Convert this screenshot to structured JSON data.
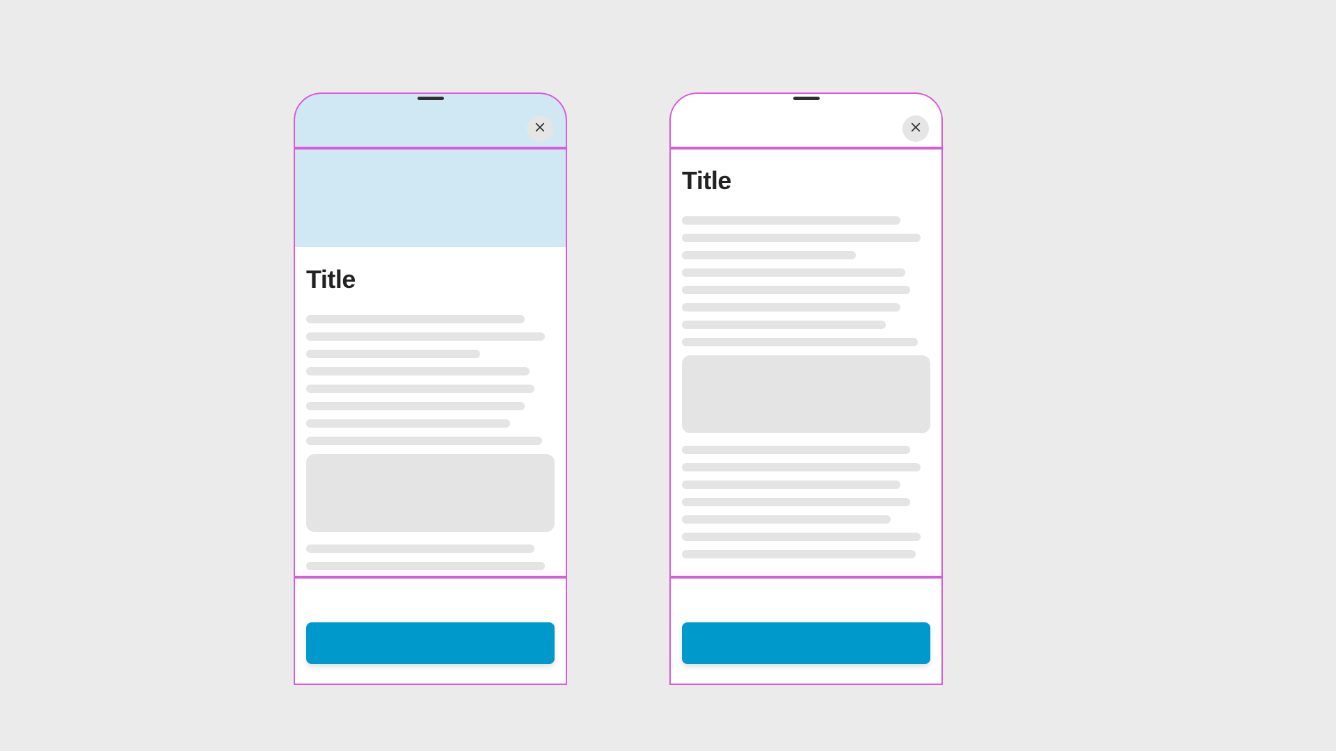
{
  "mock_left": {
    "title": "Title",
    "close_icon": "close-icon",
    "has_hero_band": true,
    "cta_color": "#0099cc"
  },
  "mock_right": {
    "title": "Title",
    "close_icon": "close-icon",
    "has_hero_band": false,
    "cta_color": "#0099cc"
  },
  "outline_color": "#d95bd9",
  "placeholder_widths_block1": [
    88,
    96,
    70,
    90,
    92,
    88,
    82,
    95
  ],
  "placeholder_widths_block2": [
    92,
    96,
    88,
    92,
    84,
    96,
    94
  ]
}
